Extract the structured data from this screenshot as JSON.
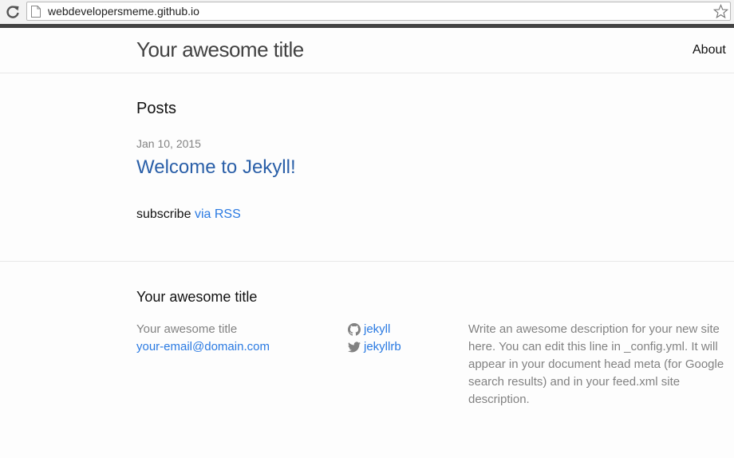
{
  "browser": {
    "url": "webdevelopersmeme.github.io",
    "icons": {
      "reload": "reload-icon",
      "page": "page-icon",
      "bookmark": "star-icon"
    }
  },
  "header": {
    "site_title": "Your awesome title",
    "nav": [
      {
        "label": "About"
      }
    ]
  },
  "main": {
    "heading": "Posts",
    "posts": [
      {
        "date": "Jan 10, 2015",
        "title": "Welcome to Jekyll!"
      }
    ],
    "rss": {
      "prefix": "subscribe",
      "link_label": "via RSS"
    }
  },
  "footer": {
    "heading": "Your awesome title",
    "name": "Your awesome title",
    "email": "your-email@domain.com",
    "social": [
      {
        "icon": "github-icon",
        "label": "jekyll"
      },
      {
        "icon": "twitter-icon",
        "label": "jekyllrb"
      }
    ],
    "description": "Write an awesome description for your new site here. You can edit this line in _config.yml. It will appear in your document head meta (for Google search results) and in your feed.xml site description."
  },
  "colors": {
    "link": "#2a7ae2",
    "post_title": "#2a5fa8",
    "muted_text": "#828282",
    "title_text": "#424242",
    "background": "#fdfdfd"
  }
}
